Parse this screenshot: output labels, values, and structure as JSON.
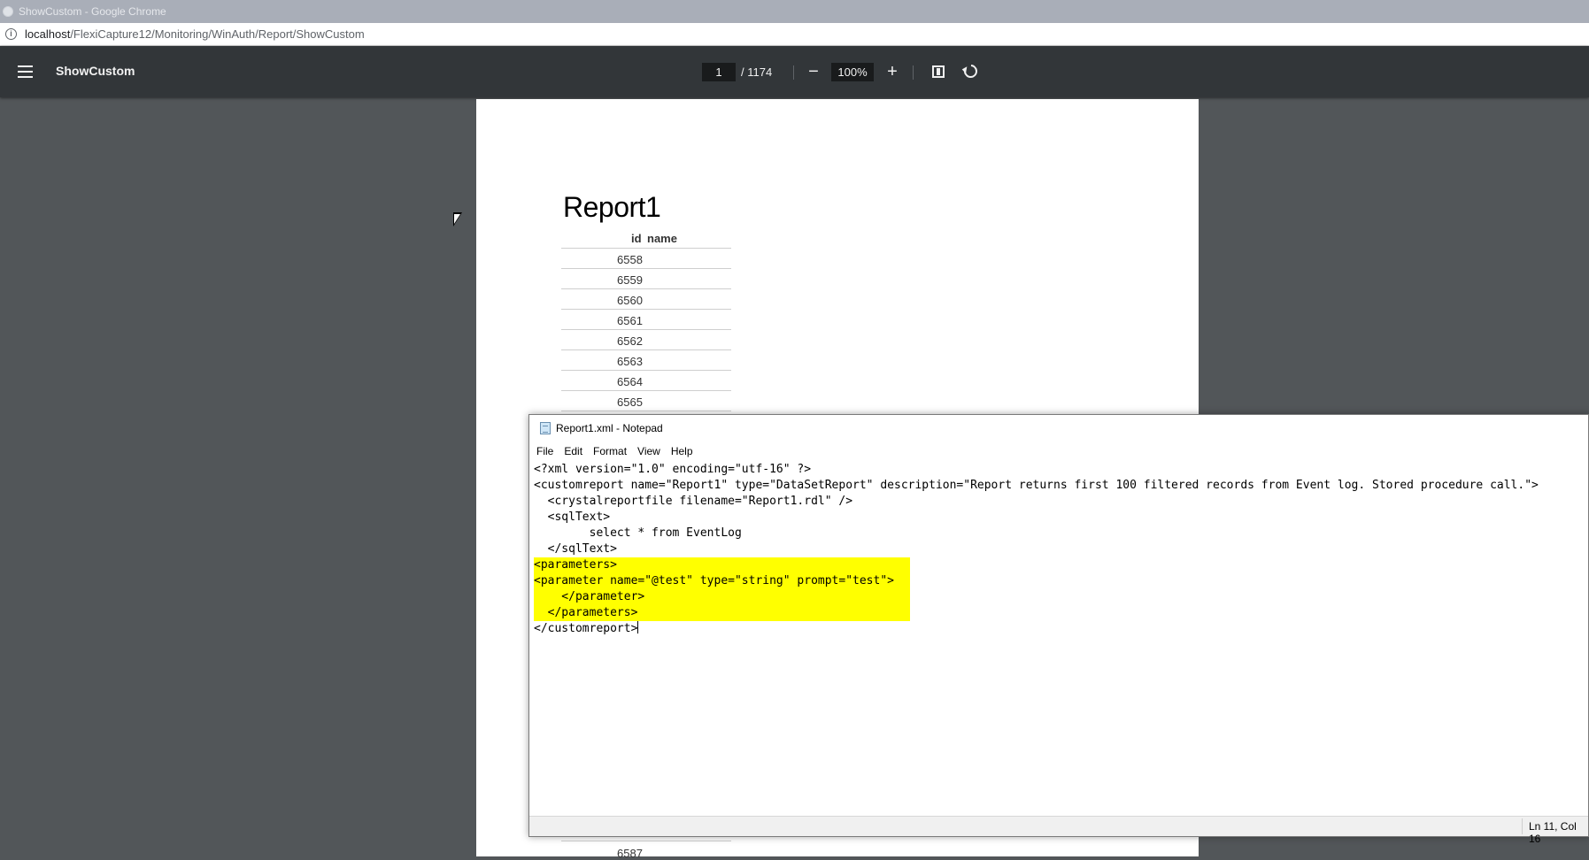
{
  "browser": {
    "window_title": "ShowCustom - Google Chrome",
    "url_host": "localhost",
    "url_path": "/FlexiCapture12/Monitoring/WinAuth/Report/ShowCustom"
  },
  "pdf_toolbar": {
    "doc_title": "ShowCustom",
    "current_page": "1",
    "page_total": "/ 1174",
    "zoom_out_label": "−",
    "zoom_level": "100%",
    "zoom_in_label": "+"
  },
  "report": {
    "title": "Report1",
    "columns": {
      "id": "id",
      "name": "name"
    },
    "rows": [
      "6558",
      "6559",
      "6560",
      "6561",
      "6562",
      "6563",
      "6564",
      "6565"
    ],
    "bottom_row": "6587"
  },
  "notepad": {
    "title": "Report1.xml - Notepad",
    "menu": [
      "File",
      "Edit",
      "Format",
      "View",
      "Help"
    ],
    "lines": [
      "<?xml version=\"1.0\" encoding=\"utf-16\" ?>",
      "<customreport name=\"Report1\" type=\"DataSetReport\" description=\"Report returns first 100 filtered records from Event log. Stored procedure call.\">",
      "  <crystalreportfile filename=\"Report1.rdl\" />",
      "  <sqlText>",
      "        select * from EventLog",
      "  </sqlText>",
      "<parameters>",
      "<parameter name=\"@test\" type=\"string\" prompt=\"test\">",
      "    </parameter>",
      "  </parameters>",
      "</customreport>"
    ],
    "status_position": "Ln 11, Col 16",
    "highlight_color": "#ffff00"
  }
}
